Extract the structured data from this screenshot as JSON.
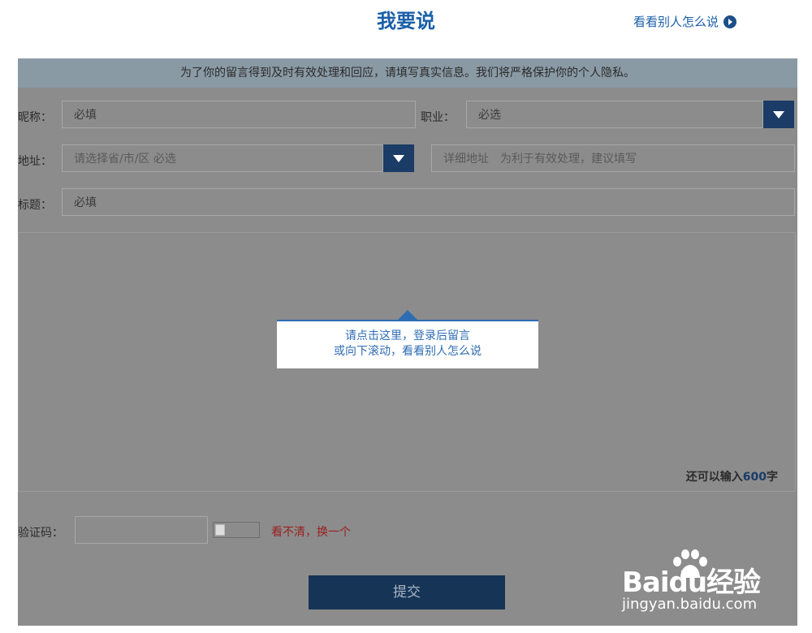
{
  "header": {
    "title": "我要说",
    "view_others": "看看别人怎么说"
  },
  "form": {
    "notice": "为了你的留言得到及时有效处理和回应，请填写真实信息。我们将严格保护你的个人隐私。",
    "nickname_label": "昵称：",
    "nickname_placeholder": "必填",
    "occupation_label": "职业：",
    "occupation_value": "必选",
    "address_label": "地址：",
    "address_placeholder": "请选择省/市/区 必选",
    "address_detail_placeholder": "详细地址　为利于有效处理，建议填写",
    "title_label": "标题：",
    "title_placeholder": "必填",
    "counter_prefix": "还可以输入",
    "counter_value": "600",
    "counter_suffix": "字",
    "captcha_label": "验证码：",
    "captcha_refresh": "看不清，换一个",
    "submit_label": "提交"
  },
  "popup": {
    "line1": "请点击这里，登录后留言",
    "line2": "或向下滚动，看看别人怎么说"
  },
  "watermark": {
    "brand": "Baidu经验",
    "url": "jingyan.baidu.com"
  }
}
